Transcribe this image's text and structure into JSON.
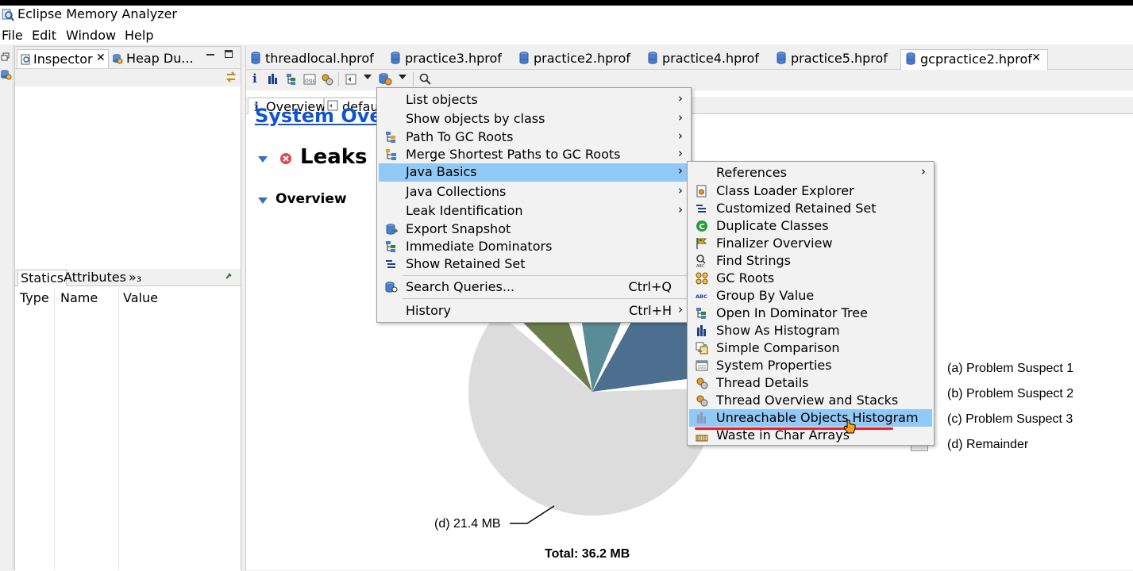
{
  "window": {
    "title": "Eclipse Memory Analyzer"
  },
  "menubar": {
    "items": [
      "File",
      "Edit",
      "Window",
      "Help"
    ]
  },
  "left_panel": {
    "tabs": [
      {
        "label": "Inspector",
        "close": "✕"
      },
      {
        "label": "Heap Du..."
      }
    ],
    "bottom_tabs": [
      "Statics",
      "Attributes",
      "»₃"
    ],
    "columns": [
      "Type",
      "Name",
      "Value"
    ]
  },
  "editor": {
    "tabs": [
      {
        "label": "threadlocal.hprof"
      },
      {
        "label": "practice3.hprof"
      },
      {
        "label": "practice2.hprof"
      },
      {
        "label": "practice4.hprof"
      },
      {
        "label": "practice5.hprof"
      },
      {
        "label": "gcpractice2.hprof",
        "active": true,
        "close": "✕"
      }
    ],
    "subtabs": [
      "Overview",
      "defaul"
    ],
    "headings": {
      "system_overview": "System Ove",
      "leaks": "Leaks",
      "overview": "Overview"
    },
    "legend": [
      {
        "label": "(a)  Problem Suspect 1"
      },
      {
        "label": "(b)  Problem Suspect 2"
      },
      {
        "label": "(c)  Problem Suspect 3"
      },
      {
        "label": "(d)  Remainder"
      }
    ],
    "pie_label": "(d)  21.4 MB",
    "total": "Total: 36.2 MB"
  },
  "context_menu": {
    "items": [
      {
        "label": "List objects",
        "arrow": "›"
      },
      {
        "label": "Show objects by class",
        "arrow": "›"
      },
      {
        "label": "Path To GC Roots",
        "arrow": "›"
      },
      {
        "label": "Merge Shortest Paths to GC Roots",
        "arrow": "›"
      },
      {
        "label": "Java Basics",
        "arrow": "›",
        "highlighted": true
      },
      {
        "label": "Java Collections",
        "arrow": "›"
      },
      {
        "label": "Leak Identification",
        "arrow": "›"
      },
      {
        "label": "Export Snapshot"
      },
      {
        "label": "Immediate Dominators"
      },
      {
        "label": "Show Retained Set"
      },
      {
        "label": "Search Queries...",
        "shortcut": "Ctrl+Q"
      },
      {
        "label": "History",
        "shortcut": "Ctrl+H",
        "arrow": "›"
      }
    ]
  },
  "submenu": {
    "items": [
      {
        "label": "References",
        "arrow": "›"
      },
      {
        "label": "Class Loader Explorer"
      },
      {
        "label": "Customized Retained Set"
      },
      {
        "label": "Duplicate Classes"
      },
      {
        "label": "Finalizer Overview"
      },
      {
        "label": "Find Strings"
      },
      {
        "label": "GC Roots"
      },
      {
        "label": "Group By Value"
      },
      {
        "label": "Open In Dominator Tree"
      },
      {
        "label": "Show As Histogram"
      },
      {
        "label": "Simple Comparison"
      },
      {
        "label": "System Properties"
      },
      {
        "label": "Thread Details"
      },
      {
        "label": "Thread Overview and Stacks"
      },
      {
        "label": "Unreachable Objects Histogram",
        "highlighted": true
      },
      {
        "label": "Waste in Char Arrays"
      }
    ]
  },
  "colors": {
    "highlight": "#90c8f6",
    "link": "#1155cc",
    "underline": "#e8202a",
    "pie_remainder": "#dcdcdc"
  }
}
